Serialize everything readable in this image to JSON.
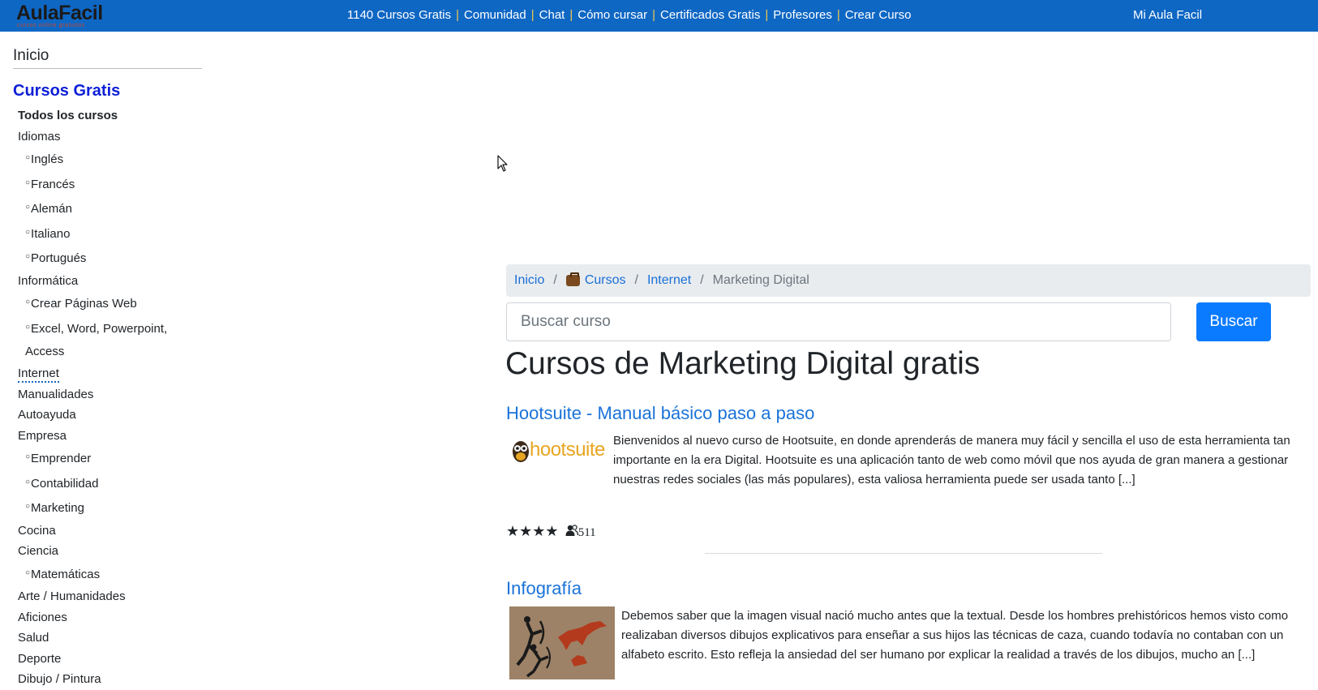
{
  "header": {
    "logo_text": "AulaFacil",
    "logo_tagline": "cursos online gratuitos",
    "nav": [
      "1140 Cursos Gratis",
      "Comunidad",
      "Chat",
      "Cómo cursar",
      "Certificados Gratis",
      "Profesores",
      "Crear Curso"
    ],
    "account_link": "Mi Aula Facil"
  },
  "sidebar": {
    "home": "Inicio",
    "section_title": "Cursos Gratis",
    "items": [
      {
        "label": "Todos los cursos",
        "level": "bold"
      },
      {
        "label": "Idiomas",
        "level": "cat"
      },
      {
        "label": "Inglés",
        "level": "sub"
      },
      {
        "label": "Francés",
        "level": "sub"
      },
      {
        "label": "Alemán",
        "level": "sub"
      },
      {
        "label": "Italiano",
        "level": "sub"
      },
      {
        "label": "Portugués",
        "level": "sub"
      },
      {
        "label": "Informática",
        "level": "cat"
      },
      {
        "label": "Crear Páginas Web",
        "level": "sub"
      },
      {
        "label": "Excel, Word, Powerpoint,",
        "level": "sub"
      },
      {
        "label": "Access",
        "level": "cont"
      },
      {
        "label": "Internet",
        "level": "cat",
        "active": true
      },
      {
        "label": "Manualidades",
        "level": "cat"
      },
      {
        "label": "Autoayuda",
        "level": "cat"
      },
      {
        "label": "Empresa",
        "level": "cat"
      },
      {
        "label": "Emprender",
        "level": "sub"
      },
      {
        "label": "Contabilidad",
        "level": "sub"
      },
      {
        "label": "Marketing",
        "level": "sub"
      },
      {
        "label": "Cocina",
        "level": "cat"
      },
      {
        "label": "Ciencia",
        "level": "cat"
      },
      {
        "label": "Matemáticas",
        "level": "sub"
      },
      {
        "label": "Arte / Humanidades",
        "level": "cat"
      },
      {
        "label": "Aficiones",
        "level": "cat"
      },
      {
        "label": "Salud",
        "level": "cat"
      },
      {
        "label": "Deporte",
        "level": "cat"
      },
      {
        "label": "Dibujo / Pintura",
        "level": "cat"
      }
    ]
  },
  "breadcrumb": {
    "home": "Inicio",
    "courses": "Cursos",
    "category": "Internet",
    "current": "Marketing Digital",
    "separator": "/"
  },
  "search": {
    "placeholder": "Buscar curso",
    "button": "Buscar"
  },
  "page_title": "Cursos de Marketing Digital gratis",
  "courses": [
    {
      "title": "Hootsuite - Manual básico paso a paso",
      "thumb_text": "hootsuite",
      "description": "Bienvenidos al nuevo curso de Hootsuite, en donde aprenderás de manera muy fácil y sencilla el uso de esta herramienta tan importante en la era Digital.   Hootsuite es una aplicación tanto de web como móvil que nos ayuda de gran manera a gestionar nuestras redes sociales (las más populares), esta valiosa herramienta puede ser usada tanto [...]",
      "stars": "★★★★",
      "rating_value": 4,
      "students": "511"
    },
    {
      "title": "Infografía",
      "description": "Debemos saber que la imagen visual nació mucho antes que la textual. Desde los hombres prehistóricos hemos visto como realizaban diversos dibujos explicativos para enseñar a sus hijos las técnicas de caza, cuando todavía no contaban con un alfabeto escrito. Esto refleja la ansiedad del ser humano por explicar la realidad a través de los dibujos, mucho an [...]"
    }
  ],
  "colors": {
    "topbar": "#0f67c4",
    "link": "#1a73d9",
    "button": "#0a7bff",
    "sidebar_title": "#0d1fd6"
  }
}
